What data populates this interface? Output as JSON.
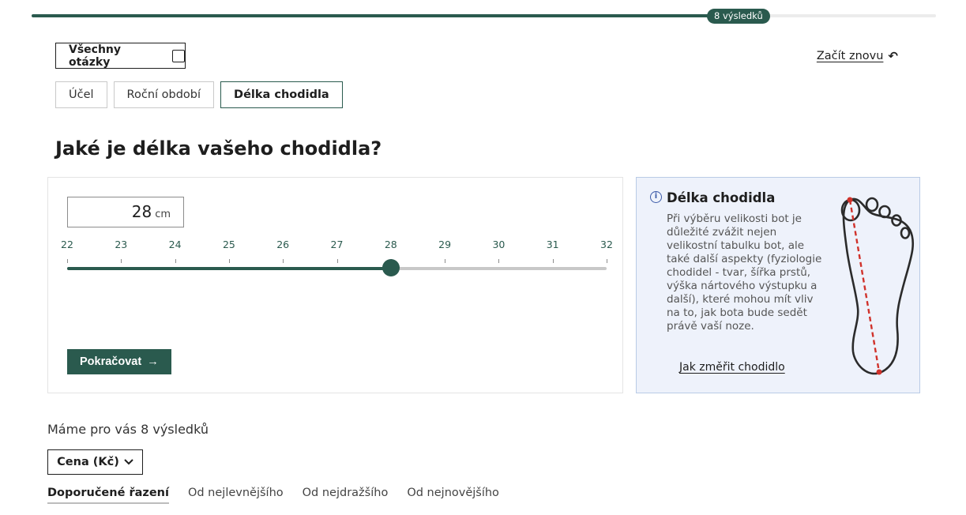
{
  "progress": {
    "badge": "8 výsledků",
    "fraction": 0.78
  },
  "header": {
    "all_questions_label": "Všechny otázky",
    "restart_label": "Začít znovu"
  },
  "tabs": [
    {
      "label": "Účel",
      "active": false
    },
    {
      "label": "Roční období",
      "active": false
    },
    {
      "label": "Délka chodidla",
      "active": true
    }
  ],
  "question": "Jaké je délka vašeho chodidla?",
  "slider": {
    "value": "28",
    "unit": "cm",
    "min": 22,
    "max": 32,
    "current": 28,
    "ticks": [
      "22",
      "23",
      "24",
      "25",
      "26",
      "27",
      "28",
      "29",
      "30",
      "31",
      "32"
    ]
  },
  "continue_label": "Pokračovat",
  "info": {
    "title": "Délka chodidla",
    "text": "Při výběru velikosti bot je důležité zvážit nejen velikostní tabulku bot, ale také další aspekty (fyziologie chodidel - tvar, šířka prstů, výška nártového výstupku a další), které mohou mít vliv na to, jak bota bude sedět právě vaší noze.",
    "link": "Jak změřit chodidlo"
  },
  "results_text": "Máme pro vás 8 výsledků",
  "price_filter": "Cena (Kč)",
  "sort_options": [
    {
      "label": "Doporučené řazení",
      "active": true
    },
    {
      "label": "Od nejlevnějšího",
      "active": false
    },
    {
      "label": "Od nejdražšího",
      "active": false
    },
    {
      "label": "Od nejnovějšího",
      "active": false
    }
  ],
  "colors": {
    "primary": "#2a5a4e",
    "info_bg": "#eef2fb",
    "info_border": "#b9cbe6",
    "measure_line": "#d0322b"
  },
  "icons": {
    "restart": "undo-arrow-icon",
    "continue": "arrow-right-icon",
    "info": "info-icon",
    "dropdown": "chevron-down-icon"
  }
}
